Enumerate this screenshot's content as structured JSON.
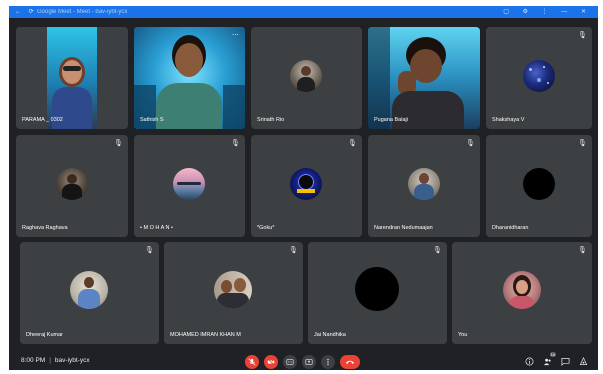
{
  "window": {
    "title": "Google Meet - Meet - bav-iybt-ycx"
  },
  "participants": [
    {
      "name": "PARAMA _ 0302",
      "muted": false,
      "type": "video"
    },
    {
      "name": "Sathish S",
      "muted": false,
      "type": "video",
      "speaking": true
    },
    {
      "name": "Srinath Rio",
      "muted": false,
      "type": "avatar"
    },
    {
      "name": "Pugana Balaji",
      "muted": false,
      "type": "video"
    },
    {
      "name": "Shakshaya V",
      "muted": true,
      "type": "avatar"
    },
    {
      "name": "Raghava Raghava",
      "muted": true,
      "type": "avatar"
    },
    {
      "name": "• M O H A N •",
      "muted": true,
      "type": "avatar"
    },
    {
      "name": "*Goku*",
      "muted": true,
      "type": "avatar"
    },
    {
      "name": "Narendran Nedumaajan",
      "muted": true,
      "type": "avatar"
    },
    {
      "name": "Dharanidharan",
      "muted": true,
      "type": "avatar"
    },
    {
      "name": "Dheeraj Kumar",
      "muted": true,
      "type": "avatar"
    },
    {
      "name": "MOHAMED IMRAN KHAN M",
      "muted": true,
      "type": "avatar"
    },
    {
      "name": "Jai Nandhika",
      "muted": true,
      "type": "avatar"
    },
    {
      "name": "You",
      "muted": true,
      "type": "avatar"
    }
  ],
  "bottom_bar": {
    "time": "8:00 PM",
    "meeting_code": "bav-iybt-ycx",
    "people_count": "14"
  },
  "colors": {
    "background": "#202124",
    "tile": "#3c4043",
    "danger": "#ea4335",
    "accent": "#1a73e8",
    "speaking_outline": "#8ab4f8"
  },
  "icons": [
    "microphone-off-icon",
    "camera-off-icon",
    "captions-icon",
    "present-icon",
    "more-options-icon",
    "end-call-icon",
    "info-icon",
    "people-icon",
    "chat-icon",
    "activities-icon"
  ]
}
